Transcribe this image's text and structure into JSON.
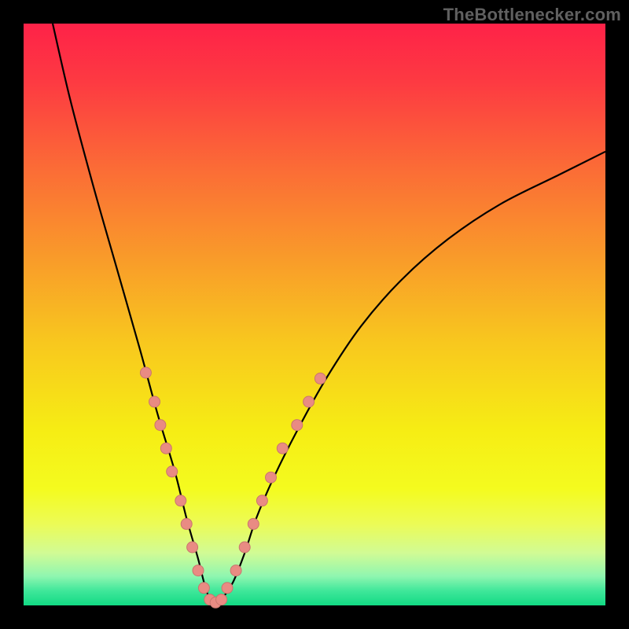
{
  "attribution": "TheBottlenecker.com",
  "colors": {
    "bg": "#000000",
    "curve_stroke": "#000000",
    "marker_fill": "#e98b83",
    "marker_stroke": "#c9766e",
    "gradient_stops": [
      {
        "offset": 0.0,
        "color": "#fe2248"
      },
      {
        "offset": 0.1,
        "color": "#fd3a42"
      },
      {
        "offset": 0.25,
        "color": "#fb6c36"
      },
      {
        "offset": 0.4,
        "color": "#f99a2a"
      },
      {
        "offset": 0.55,
        "color": "#f8c81e"
      },
      {
        "offset": 0.7,
        "color": "#f6ed14"
      },
      {
        "offset": 0.8,
        "color": "#f4fb1f"
      },
      {
        "offset": 0.86,
        "color": "#ecfb56"
      },
      {
        "offset": 0.91,
        "color": "#d1fb95"
      },
      {
        "offset": 0.95,
        "color": "#8ff6b0"
      },
      {
        "offset": 0.975,
        "color": "#3fe79a"
      },
      {
        "offset": 1.0,
        "color": "#12da84"
      }
    ]
  },
  "chart_data": {
    "type": "line",
    "title": "",
    "xlabel": "",
    "ylabel": "",
    "xlim": [
      0,
      100
    ],
    "ylim": [
      0,
      100
    ],
    "series": [
      {
        "name": "bottleneck-curve",
        "x": [
          5,
          8,
          12,
          16,
          20,
          23,
          26,
          28,
          30,
          31,
          32,
          33,
          34,
          36,
          38,
          40,
          43,
          47,
          52,
          58,
          65,
          73,
          82,
          92,
          100
        ],
        "y": [
          100,
          87,
          72,
          58,
          44,
          33,
          23,
          15,
          8,
          4,
          1,
          0,
          1,
          4,
          9,
          15,
          22,
          30,
          39,
          48,
          56,
          63,
          69,
          74,
          78
        ]
      }
    ],
    "markers": [
      {
        "x": 21.0,
        "y": 40
      },
      {
        "x": 22.5,
        "y": 35
      },
      {
        "x": 23.5,
        "y": 31
      },
      {
        "x": 24.5,
        "y": 27
      },
      {
        "x": 25.5,
        "y": 23
      },
      {
        "x": 27.0,
        "y": 18
      },
      {
        "x": 28.0,
        "y": 14
      },
      {
        "x": 29.0,
        "y": 10
      },
      {
        "x": 30.0,
        "y": 6
      },
      {
        "x": 31.0,
        "y": 3
      },
      {
        "x": 32.0,
        "y": 1
      },
      {
        "x": 33.0,
        "y": 0.5
      },
      {
        "x": 34.0,
        "y": 1
      },
      {
        "x": 35.0,
        "y": 3
      },
      {
        "x": 36.5,
        "y": 6
      },
      {
        "x": 38.0,
        "y": 10
      },
      {
        "x": 39.5,
        "y": 14
      },
      {
        "x": 41.0,
        "y": 18
      },
      {
        "x": 42.5,
        "y": 22
      },
      {
        "x": 44.5,
        "y": 27
      },
      {
        "x": 47.0,
        "y": 31
      },
      {
        "x": 49.0,
        "y": 35
      },
      {
        "x": 51.0,
        "y": 39
      }
    ]
  }
}
